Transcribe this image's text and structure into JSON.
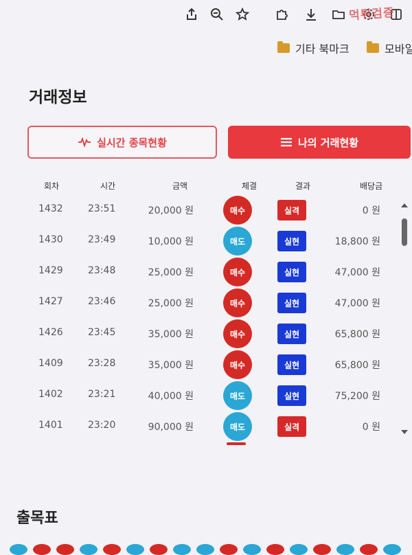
{
  "toolbar": {
    "icons": [
      "share-icon",
      "zoom-icon",
      "favorite-icon",
      "extension-icon",
      "download-icon",
      "folder-icon",
      "settings-icon",
      "sidebar-icon"
    ],
    "watermark": "먹튀검증"
  },
  "bookmarks": [
    {
      "label": "기타 북마크"
    },
    {
      "label": "모바일"
    }
  ],
  "section_title": "거래정보",
  "buttons": {
    "live": "실시간 종목현황",
    "mine": "나의 거래현황"
  },
  "table": {
    "headers": [
      "회차",
      "시간",
      "금액",
      "체결",
      "결과",
      "배당금"
    ],
    "rows": [
      {
        "round": "1432",
        "time": "23:51",
        "amount": "20,000 원",
        "side": "매수",
        "side_type": "buy",
        "result": "실격",
        "result_type": "lose",
        "dividend": "0 원"
      },
      {
        "round": "1430",
        "time": "23:49",
        "amount": "10,000 원",
        "side": "매도",
        "side_type": "sell",
        "result": "실현",
        "result_type": "win",
        "dividend": "18,800 원"
      },
      {
        "round": "1429",
        "time": "23:48",
        "amount": "25,000 원",
        "side": "매수",
        "side_type": "buy",
        "result": "실현",
        "result_type": "win",
        "dividend": "47,000 원"
      },
      {
        "round": "1427",
        "time": "23:46",
        "amount": "25,000 원",
        "side": "매수",
        "side_type": "buy",
        "result": "실현",
        "result_type": "win",
        "dividend": "47,000 원"
      },
      {
        "round": "1426",
        "time": "23:45",
        "amount": "35,000 원",
        "side": "매수",
        "side_type": "buy",
        "result": "실현",
        "result_type": "win",
        "dividend": "65,800 원"
      },
      {
        "round": "1409",
        "time": "23:28",
        "amount": "35,000 원",
        "side": "매수",
        "side_type": "buy",
        "result": "실현",
        "result_type": "win",
        "dividend": "65,800 원"
      },
      {
        "round": "1402",
        "time": "23:21",
        "amount": "40,000 원",
        "side": "매도",
        "side_type": "sell",
        "result": "실현",
        "result_type": "win",
        "dividend": "75,200 원"
      },
      {
        "round": "1401",
        "time": "23:20",
        "amount": "90,000 원",
        "side": "매도",
        "side_type": "sell",
        "result": "실격",
        "result_type": "lose",
        "dividend": "0 원"
      }
    ]
  },
  "sub_title": "출목표",
  "colors": {
    "accent_red": "#e8393f",
    "buy": "#d42a25",
    "sell": "#2aa7d4",
    "win": "#1a3ad6",
    "lose": "#d62a2a"
  }
}
